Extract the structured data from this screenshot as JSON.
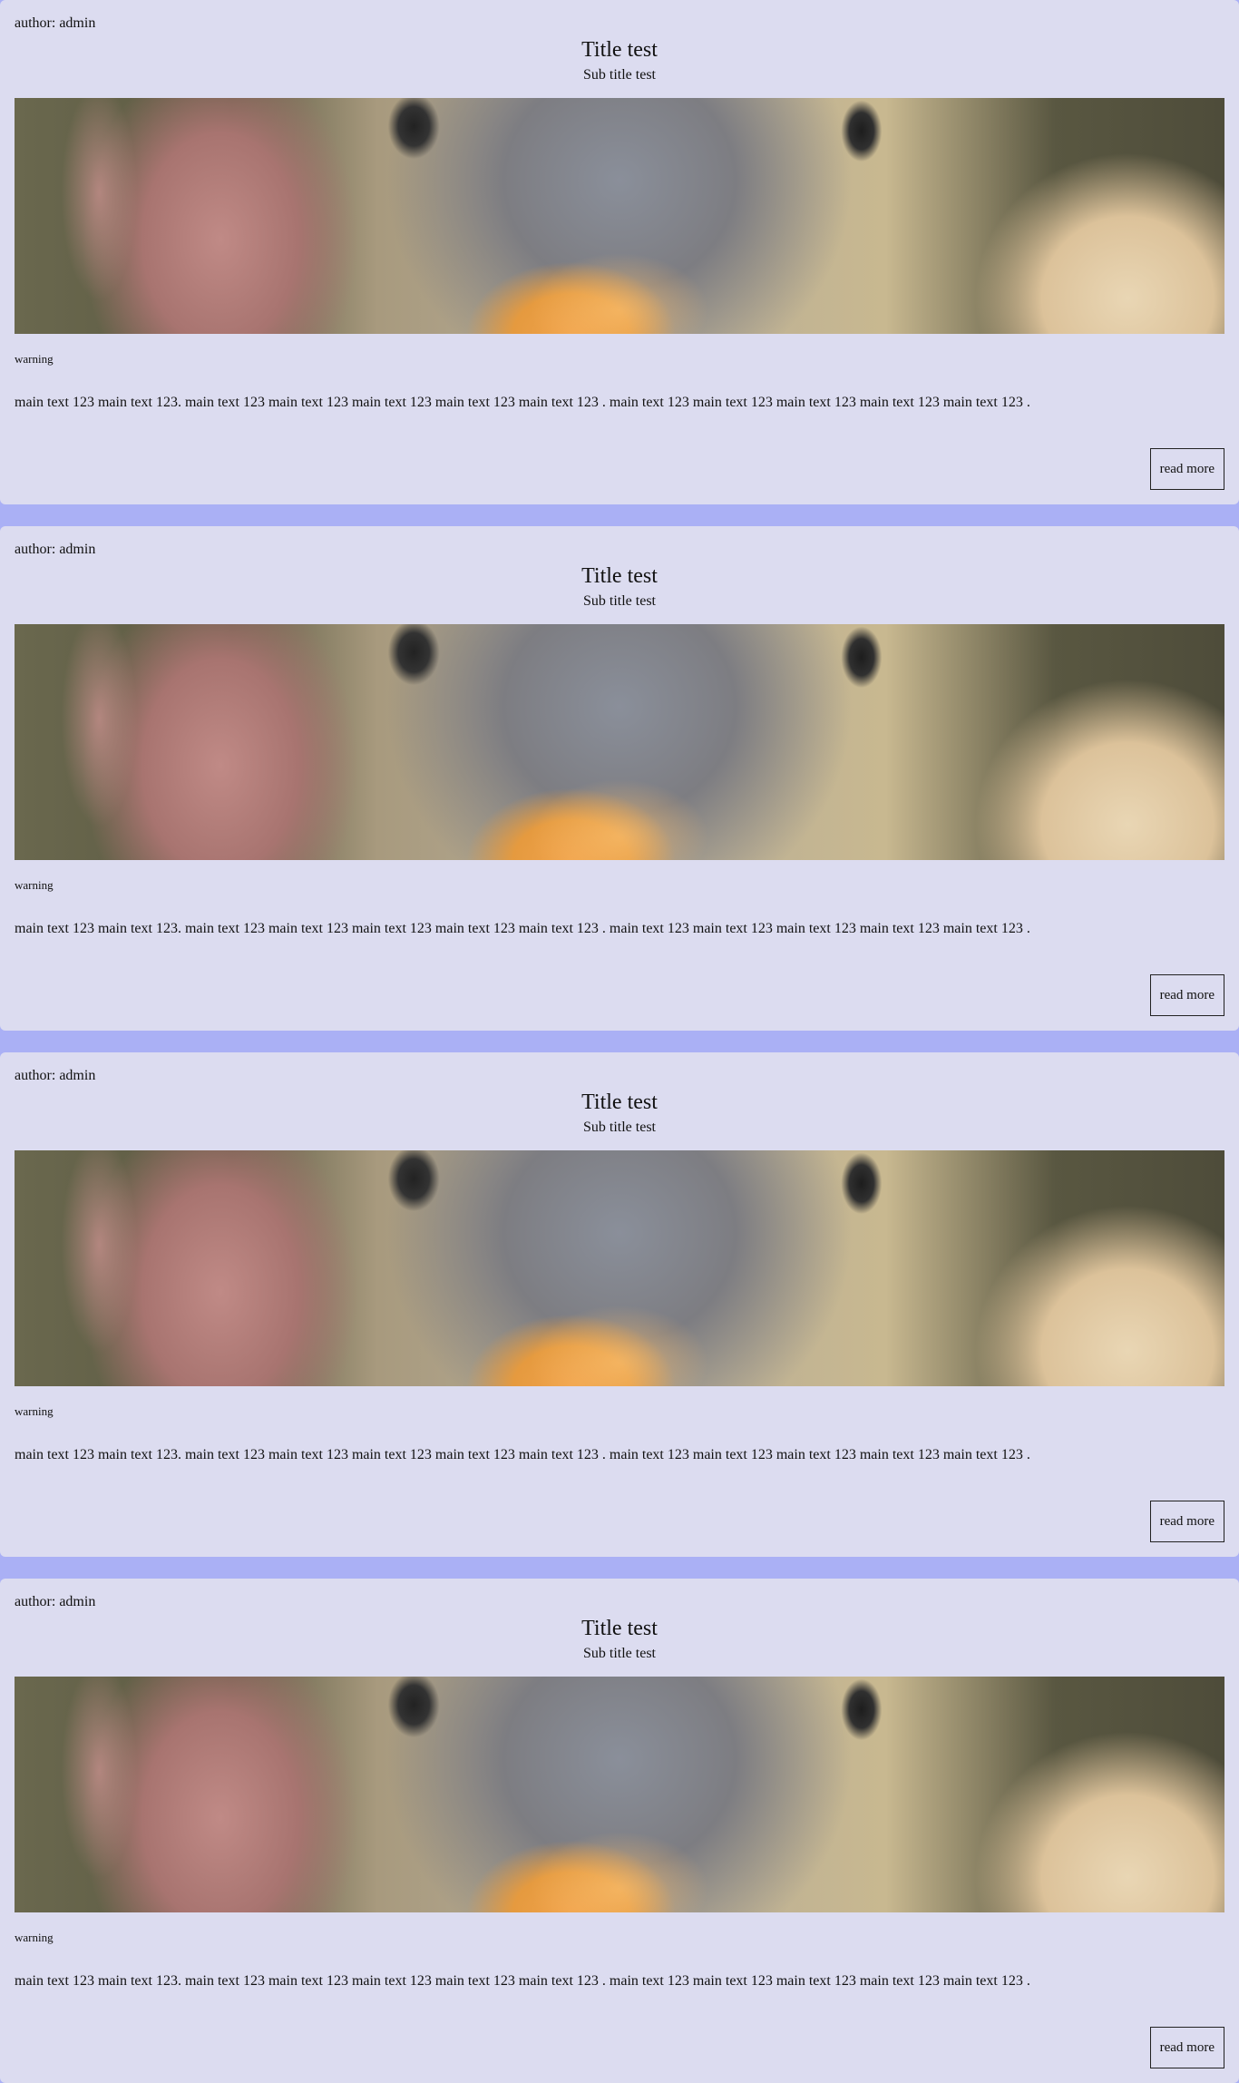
{
  "posts": [
    {
      "author": "author: admin",
      "title": "Title test",
      "subtitle": "Sub title test",
      "warning": "warning",
      "main_text": "main text 123 main text 123. main text 123 main text 123 main text 123 main text 123 main text 123 . main text 123 main text 123 main text 123 main text 123 main text 123 .",
      "read_more": "read more"
    },
    {
      "author": "author: admin",
      "title": "Title test",
      "subtitle": "Sub title test",
      "warning": "warning",
      "main_text": "main text 123 main text 123. main text 123 main text 123 main text 123 main text 123 main text 123 . main text 123 main text 123 main text 123 main text 123 main text 123 .",
      "read_more": "read more"
    },
    {
      "author": "author: admin",
      "title": "Title test",
      "subtitle": "Sub title test",
      "warning": "warning",
      "main_text": "main text 123 main text 123. main text 123 main text 123 main text 123 main text 123 main text 123 . main text 123 main text 123 main text 123 main text 123 main text 123 .",
      "read_more": "read more"
    },
    {
      "author": "author: admin",
      "title": "Title test",
      "subtitle": "Sub title test",
      "warning": "warning",
      "main_text": "main text 123 main text 123. main text 123 main text 123 main text 123 main text 123 main text 123 . main text 123 main text 123 main text 123 main text 123 main text 123 .",
      "read_more": "read more"
    }
  ],
  "colors": {
    "page_background": "#aab0f5",
    "card_background": "#dcdcf0",
    "text": "#111111"
  }
}
